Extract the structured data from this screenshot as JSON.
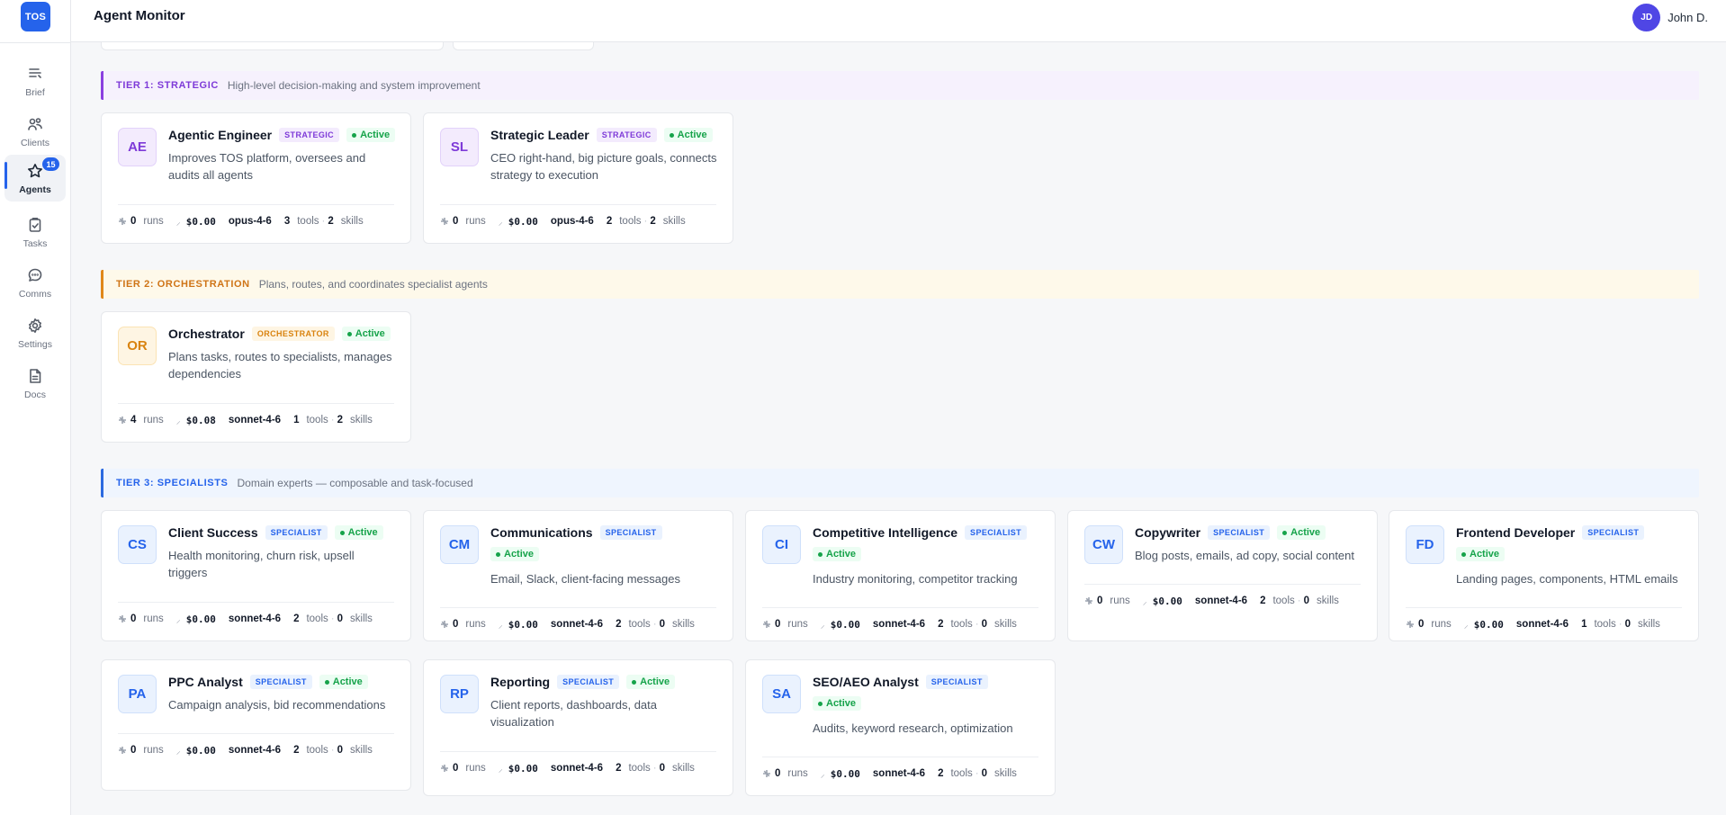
{
  "app": {
    "logo": "TOS",
    "page_title": "Agent Monitor"
  },
  "user": {
    "initials": "JD",
    "name": "John D."
  },
  "sidebar": {
    "items": [
      {
        "label": "Brief",
        "icon": "brief-icon"
      },
      {
        "label": "Clients",
        "icon": "clients-icon"
      },
      {
        "label": "Agents",
        "icon": "star-icon",
        "badge": "15",
        "active": true
      },
      {
        "label": "Tasks",
        "icon": "clipboard-check-icon"
      },
      {
        "label": "Comms",
        "icon": "chat-bubble-icon"
      },
      {
        "label": "Settings",
        "icon": "gear-icon"
      },
      {
        "label": "Docs",
        "icon": "document-icon"
      }
    ]
  },
  "tiers": [
    {
      "name": "TIER 1: STRATEGIC",
      "description": "High-level decision-making and system improvement",
      "agents": [
        {
          "initials": "AE",
          "name": "Agentic Engineer",
          "tag": "STRATEGIC",
          "status": "Active",
          "description": "Improves TOS platform, oversees and audits all agents",
          "runs": "0",
          "runs_label": "runs",
          "cost": "$0.00",
          "model": "opus-4-6",
          "tools": "3",
          "tools_label": "tools",
          "skills": "2",
          "skills_label": "skills"
        },
        {
          "initials": "SL",
          "name": "Strategic Leader",
          "tag": "STRATEGIC",
          "status": "Active",
          "description": "CEO right-hand, big picture goals, connects strategy to execution",
          "runs": "0",
          "runs_label": "runs",
          "cost": "$0.00",
          "model": "opus-4-6",
          "tools": "2",
          "tools_label": "tools",
          "skills": "2",
          "skills_label": "skills"
        }
      ]
    },
    {
      "name": "TIER 2: ORCHESTRATION",
      "description": "Plans, routes, and coordinates specialist agents",
      "agents": [
        {
          "initials": "OR",
          "name": "Orchestrator",
          "tag": "ORCHESTRATOR",
          "status": "Active",
          "description": "Plans tasks, routes to specialists, manages dependencies",
          "runs": "4",
          "runs_label": "runs",
          "cost": "$0.08",
          "model": "sonnet-4-6",
          "tools": "1",
          "tools_label": "tools",
          "skills": "2",
          "skills_label": "skills"
        }
      ]
    },
    {
      "name": "TIER 3: SPECIALISTS",
      "description": "Domain experts — composable and task-focused",
      "agents": [
        {
          "initials": "CS",
          "name": "Client Success",
          "tag": "SPECIALIST",
          "status": "Active",
          "description": "Health monitoring, churn risk, upsell triggers",
          "runs": "0",
          "runs_label": "runs",
          "cost": "$0.00",
          "model": "sonnet-4-6",
          "tools": "2",
          "tools_label": "tools",
          "skills": "0",
          "skills_label": "skills"
        },
        {
          "initials": "CM",
          "name": "Communications",
          "tag": "SPECIALIST",
          "status": "Active",
          "description": "Email, Slack, client-facing messages",
          "runs": "0",
          "runs_label": "runs",
          "cost": "$0.00",
          "model": "sonnet-4-6",
          "tools": "2",
          "tools_label": "tools",
          "skills": "0",
          "skills_label": "skills"
        },
        {
          "initials": "CI",
          "name": "Competitive Intelligence",
          "tag": "SPECIALIST",
          "status": "Active",
          "description": "Industry monitoring, competitor tracking",
          "runs": "0",
          "runs_label": "runs",
          "cost": "$0.00",
          "model": "sonnet-4-6",
          "tools": "2",
          "tools_label": "tools",
          "skills": "0",
          "skills_label": "skills"
        },
        {
          "initials": "CW",
          "name": "Copywriter",
          "tag": "SPECIALIST",
          "status": "Active",
          "description": "Blog posts, emails, ad copy, social content",
          "runs": "0",
          "runs_label": "runs",
          "cost": "$0.00",
          "model": "sonnet-4-6",
          "tools": "2",
          "tools_label": "tools",
          "skills": "0",
          "skills_label": "skills"
        },
        {
          "initials": "FD",
          "name": "Frontend Developer",
          "tag": "SPECIALIST",
          "status": "Active",
          "description": "Landing pages, components, HTML emails",
          "runs": "0",
          "runs_label": "runs",
          "cost": "$0.00",
          "model": "sonnet-4-6",
          "tools": "1",
          "tools_label": "tools",
          "skills": "0",
          "skills_label": "skills"
        },
        {
          "initials": "PA",
          "name": "PPC Analyst",
          "tag": "SPECIALIST",
          "status": "Active",
          "description": "Campaign analysis, bid recommendations",
          "runs": "0",
          "runs_label": "runs",
          "cost": "$0.00",
          "model": "sonnet-4-6",
          "tools": "2",
          "tools_label": "tools",
          "skills": "0",
          "skills_label": "skills"
        },
        {
          "initials": "RP",
          "name": "Reporting",
          "tag": "SPECIALIST",
          "status": "Active",
          "description": "Client reports, dashboards, data visualization",
          "runs": "0",
          "runs_label": "runs",
          "cost": "$0.00",
          "model": "sonnet-4-6",
          "tools": "2",
          "tools_label": "tools",
          "skills": "0",
          "skills_label": "skills"
        },
        {
          "initials": "SA",
          "name": "SEO/AEO Analyst",
          "tag": "SPECIALIST",
          "status": "Active",
          "description": "Audits, keyword research, optimization",
          "runs": "0",
          "runs_label": "runs",
          "cost": "$0.00",
          "model": "sonnet-4-6",
          "tools": "2",
          "tools_label": "tools",
          "skills": "0",
          "skills_label": "skills"
        }
      ]
    }
  ]
}
